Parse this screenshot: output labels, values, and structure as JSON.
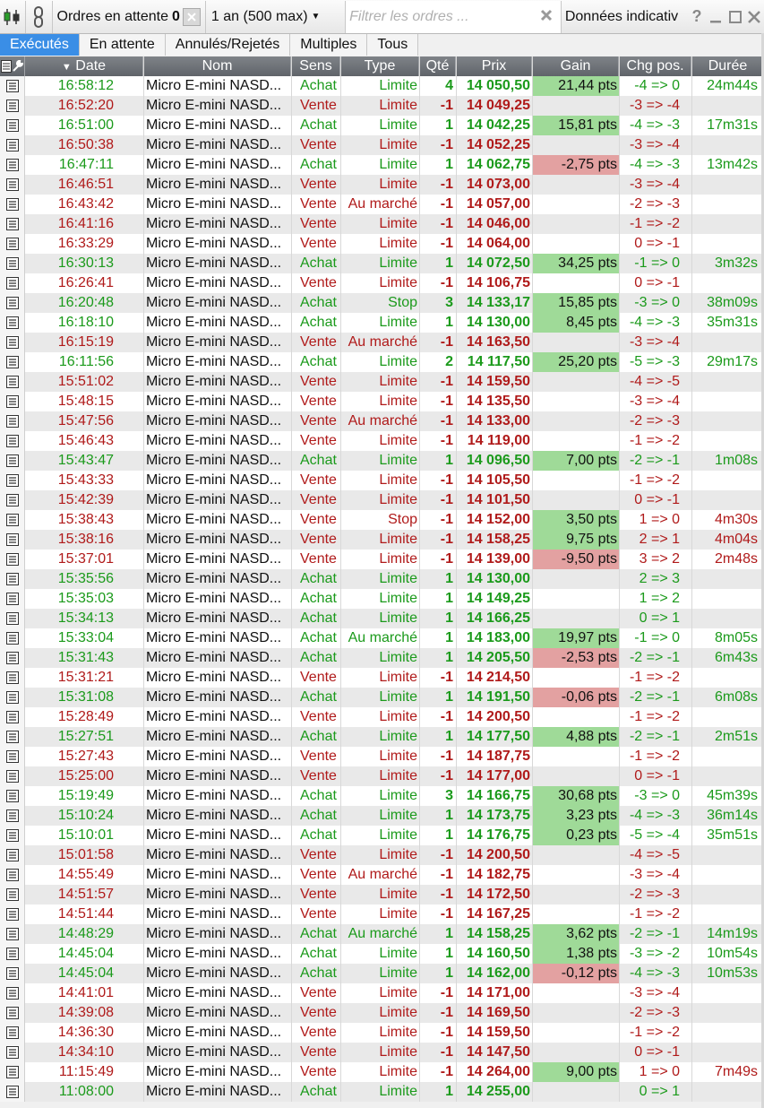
{
  "toolbar": {
    "orders_label": "Ordres en attente",
    "orders_count": "0",
    "period": "1 an (500 max)",
    "filter_placeholder": "Filtrer les ordres ...",
    "data_label": "Données indicativ"
  },
  "tabs": [
    {
      "label": "Exécutés",
      "active": true
    },
    {
      "label": "En attente"
    },
    {
      "label": "Annulés/Rejetés"
    },
    {
      "label": "Multiples"
    },
    {
      "label": "Tous"
    }
  ],
  "columns": {
    "date": "Date",
    "nom": "Nom",
    "sens": "Sens",
    "type": "Type",
    "qte": "Qté",
    "prix": "Prix",
    "gain": "Gain",
    "chg": "Chg pos.",
    "duree": "Durée"
  },
  "colors": {
    "buy": "#1b9a1b",
    "sell": "#b01a1a",
    "gain_pos": "#9fda98",
    "gain_neg": "#e3a1a1",
    "active_tab": "#3a8ee6"
  },
  "rows": [
    {
      "date": "16:58:12",
      "nom": "Micro E-mini NASD...",
      "sens": "Achat",
      "type": "Limite",
      "qte": "4",
      "prix": "14 050,50",
      "gain": "21,44 pts",
      "gain_class": "pos",
      "chg": "-4 => 0",
      "duree": "24m44s",
      "duree_class": "buy"
    },
    {
      "date": "16:52:20",
      "nom": "Micro E-mini NASD...",
      "sens": "Vente",
      "type": "Limite",
      "qte": "-1",
      "prix": "14 049,25",
      "gain": "",
      "gain_class": "",
      "chg": "-3 => -4",
      "duree": "",
      "duree_class": ""
    },
    {
      "date": "16:51:00",
      "nom": "Micro E-mini NASD...",
      "sens": "Achat",
      "type": "Limite",
      "qte": "1",
      "prix": "14 042,25",
      "gain": "15,81 pts",
      "gain_class": "pos",
      "chg": "-4 => -3",
      "duree": "17m31s",
      "duree_class": "buy"
    },
    {
      "date": "16:50:38",
      "nom": "Micro E-mini NASD...",
      "sens": "Vente",
      "type": "Limite",
      "qte": "-1",
      "prix": "14 052,25",
      "gain": "",
      "gain_class": "",
      "chg": "-3 => -4",
      "duree": "",
      "duree_class": ""
    },
    {
      "date": "16:47:11",
      "nom": "Micro E-mini NASD...",
      "sens": "Achat",
      "type": "Limite",
      "qte": "1",
      "prix": "14 062,75",
      "gain": "-2,75 pts",
      "gain_class": "neg",
      "chg": "-4 => -3",
      "duree": "13m42s",
      "duree_class": "buy"
    },
    {
      "date": "16:46:51",
      "nom": "Micro E-mini NASD...",
      "sens": "Vente",
      "type": "Limite",
      "qte": "-1",
      "prix": "14 073,00",
      "gain": "",
      "gain_class": "",
      "chg": "-3 => -4",
      "duree": "",
      "duree_class": ""
    },
    {
      "date": "16:43:42",
      "nom": "Micro E-mini NASD...",
      "sens": "Vente",
      "type": "Au marché",
      "qte": "-1",
      "prix": "14 057,00",
      "gain": "",
      "gain_class": "",
      "chg": "-2 => -3",
      "duree": "",
      "duree_class": ""
    },
    {
      "date": "16:41:16",
      "nom": "Micro E-mini NASD...",
      "sens": "Vente",
      "type": "Limite",
      "qte": "-1",
      "prix": "14 046,00",
      "gain": "",
      "gain_class": "",
      "chg": "-1 => -2",
      "duree": "",
      "duree_class": ""
    },
    {
      "date": "16:33:29",
      "nom": "Micro E-mini NASD...",
      "sens": "Vente",
      "type": "Limite",
      "qte": "-1",
      "prix": "14 064,00",
      "gain": "",
      "gain_class": "",
      "chg": "0 => -1",
      "duree": "",
      "duree_class": ""
    },
    {
      "date": "16:30:13",
      "nom": "Micro E-mini NASD...",
      "sens": "Achat",
      "type": "Limite",
      "qte": "1",
      "prix": "14 072,50",
      "gain": "34,25 pts",
      "gain_class": "pos",
      "chg": "-1 => 0",
      "duree": "3m32s",
      "duree_class": "buy"
    },
    {
      "date": "16:26:41",
      "nom": "Micro E-mini NASD...",
      "sens": "Vente",
      "type": "Limite",
      "qte": "-1",
      "prix": "14 106,75",
      "gain": "",
      "gain_class": "",
      "chg": "0 => -1",
      "duree": "",
      "duree_class": ""
    },
    {
      "date": "16:20:48",
      "nom": "Micro E-mini NASD...",
      "sens": "Achat",
      "type": "Stop",
      "qte": "3",
      "prix": "14 133,17",
      "gain": "15,85 pts",
      "gain_class": "pos",
      "chg": "-3 => 0",
      "duree": "38m09s",
      "duree_class": "buy"
    },
    {
      "date": "16:18:10",
      "nom": "Micro E-mini NASD...",
      "sens": "Achat",
      "type": "Limite",
      "qte": "1",
      "prix": "14 130,00",
      "gain": "8,45 pts",
      "gain_class": "pos",
      "chg": "-4 => -3",
      "duree": "35m31s",
      "duree_class": "buy"
    },
    {
      "date": "16:15:19",
      "nom": "Micro E-mini NASD...",
      "sens": "Vente",
      "type": "Au marché",
      "qte": "-1",
      "prix": "14 163,50",
      "gain": "",
      "gain_class": "",
      "chg": "-3 => -4",
      "duree": "",
      "duree_class": ""
    },
    {
      "date": "16:11:56",
      "nom": "Micro E-mini NASD...",
      "sens": "Achat",
      "type": "Limite",
      "qte": "2",
      "prix": "14 117,50",
      "gain": "25,20 pts",
      "gain_class": "pos",
      "chg": "-5 => -3",
      "duree": "29m17s",
      "duree_class": "buy"
    },
    {
      "date": "15:51:02",
      "nom": "Micro E-mini NASD...",
      "sens": "Vente",
      "type": "Limite",
      "qte": "-1",
      "prix": "14 159,50",
      "gain": "",
      "gain_class": "",
      "chg": "-4 => -5",
      "duree": "",
      "duree_class": ""
    },
    {
      "date": "15:48:15",
      "nom": "Micro E-mini NASD...",
      "sens": "Vente",
      "type": "Limite",
      "qte": "-1",
      "prix": "14 135,50",
      "gain": "",
      "gain_class": "",
      "chg": "-3 => -4",
      "duree": "",
      "duree_class": ""
    },
    {
      "date": "15:47:56",
      "nom": "Micro E-mini NASD...",
      "sens": "Vente",
      "type": "Au marché",
      "qte": "-1",
      "prix": "14 133,00",
      "gain": "",
      "gain_class": "",
      "chg": "-2 => -3",
      "duree": "",
      "duree_class": ""
    },
    {
      "date": "15:46:43",
      "nom": "Micro E-mini NASD...",
      "sens": "Vente",
      "type": "Limite",
      "qte": "-1",
      "prix": "14 119,00",
      "gain": "",
      "gain_class": "",
      "chg": "-1 => -2",
      "duree": "",
      "duree_class": ""
    },
    {
      "date": "15:43:47",
      "nom": "Micro E-mini NASD...",
      "sens": "Achat",
      "type": "Limite",
      "qte": "1",
      "prix": "14 096,50",
      "gain": "7,00 pts",
      "gain_class": "pos",
      "chg": "-2 => -1",
      "duree": "1m08s",
      "duree_class": "buy"
    },
    {
      "date": "15:43:33",
      "nom": "Micro E-mini NASD...",
      "sens": "Vente",
      "type": "Limite",
      "qte": "-1",
      "prix": "14 105,50",
      "gain": "",
      "gain_class": "",
      "chg": "-1 => -2",
      "duree": "",
      "duree_class": ""
    },
    {
      "date": "15:42:39",
      "nom": "Micro E-mini NASD...",
      "sens": "Vente",
      "type": "Limite",
      "qte": "-1",
      "prix": "14 101,50",
      "gain": "",
      "gain_class": "",
      "chg": "0 => -1",
      "duree": "",
      "duree_class": ""
    },
    {
      "date": "15:38:43",
      "nom": "Micro E-mini NASD...",
      "sens": "Vente",
      "type": "Stop",
      "qte": "-1",
      "prix": "14 152,00",
      "gain": "3,50 pts",
      "gain_class": "pos",
      "chg": "1 => 0",
      "duree": "4m30s",
      "duree_class": "sell"
    },
    {
      "date": "15:38:16",
      "nom": "Micro E-mini NASD...",
      "sens": "Vente",
      "type": "Limite",
      "qte": "-1",
      "prix": "14 158,25",
      "gain": "9,75 pts",
      "gain_class": "pos",
      "chg": "2 => 1",
      "duree": "4m04s",
      "duree_class": "sell"
    },
    {
      "date": "15:37:01",
      "nom": "Micro E-mini NASD...",
      "sens": "Vente",
      "type": "Limite",
      "qte": "-1",
      "prix": "14 139,00",
      "gain": "-9,50 pts",
      "gain_class": "neg",
      "chg": "3 => 2",
      "duree": "2m48s",
      "duree_class": "sell"
    },
    {
      "date": "15:35:56",
      "nom": "Micro E-mini NASD...",
      "sens": "Achat",
      "type": "Limite",
      "qte": "1",
      "prix": "14 130,00",
      "gain": "",
      "gain_class": "",
      "chg": "2 => 3",
      "duree": "",
      "duree_class": ""
    },
    {
      "date": "15:35:03",
      "nom": "Micro E-mini NASD...",
      "sens": "Achat",
      "type": "Limite",
      "qte": "1",
      "prix": "14 149,25",
      "gain": "",
      "gain_class": "",
      "chg": "1 => 2",
      "duree": "",
      "duree_class": ""
    },
    {
      "date": "15:34:13",
      "nom": "Micro E-mini NASD...",
      "sens": "Achat",
      "type": "Limite",
      "qte": "1",
      "prix": "14 166,25",
      "gain": "",
      "gain_class": "",
      "chg": "0 => 1",
      "duree": "",
      "duree_class": ""
    },
    {
      "date": "15:33:04",
      "nom": "Micro E-mini NASD...",
      "sens": "Achat",
      "type": "Au marché",
      "qte": "1",
      "prix": "14 183,00",
      "gain": "19,97 pts",
      "gain_class": "pos",
      "chg": "-1 => 0",
      "duree": "8m05s",
      "duree_class": "buy"
    },
    {
      "date": "15:31:43",
      "nom": "Micro E-mini NASD...",
      "sens": "Achat",
      "type": "Limite",
      "qte": "1",
      "prix": "14 205,50",
      "gain": "-2,53 pts",
      "gain_class": "neg",
      "chg": "-2 => -1",
      "duree": "6m43s",
      "duree_class": "buy"
    },
    {
      "date": "15:31:21",
      "nom": "Micro E-mini NASD...",
      "sens": "Vente",
      "type": "Limite",
      "qte": "-1",
      "prix": "14 214,50",
      "gain": "",
      "gain_class": "",
      "chg": "-1 => -2",
      "duree": "",
      "duree_class": ""
    },
    {
      "date": "15:31:08",
      "nom": "Micro E-mini NASD...",
      "sens": "Achat",
      "type": "Limite",
      "qte": "1",
      "prix": "14 191,50",
      "gain": "-0,06 pts",
      "gain_class": "neg",
      "chg": "-2 => -1",
      "duree": "6m08s",
      "duree_class": "buy"
    },
    {
      "date": "15:28:49",
      "nom": "Micro E-mini NASD...",
      "sens": "Vente",
      "type": "Limite",
      "qte": "-1",
      "prix": "14 200,50",
      "gain": "",
      "gain_class": "",
      "chg": "-1 => -2",
      "duree": "",
      "duree_class": ""
    },
    {
      "date": "15:27:51",
      "nom": "Micro E-mini NASD...",
      "sens": "Achat",
      "type": "Limite",
      "qte": "1",
      "prix": "14 177,50",
      "gain": "4,88 pts",
      "gain_class": "pos",
      "chg": "-2 => -1",
      "duree": "2m51s",
      "duree_class": "buy"
    },
    {
      "date": "15:27:43",
      "nom": "Micro E-mini NASD...",
      "sens": "Vente",
      "type": "Limite",
      "qte": "-1",
      "prix": "14 187,75",
      "gain": "",
      "gain_class": "",
      "chg": "-1 => -2",
      "duree": "",
      "duree_class": ""
    },
    {
      "date": "15:25:00",
      "nom": "Micro E-mini NASD...",
      "sens": "Vente",
      "type": "Limite",
      "qte": "-1",
      "prix": "14 177,00",
      "gain": "",
      "gain_class": "",
      "chg": "0 => -1",
      "duree": "",
      "duree_class": ""
    },
    {
      "date": "15:19:49",
      "nom": "Micro E-mini NASD...",
      "sens": "Achat",
      "type": "Limite",
      "qte": "3",
      "prix": "14 166,75",
      "gain": "30,68 pts",
      "gain_class": "pos",
      "chg": "-3 => 0",
      "duree": "45m39s",
      "duree_class": "buy"
    },
    {
      "date": "15:10:24",
      "nom": "Micro E-mini NASD...",
      "sens": "Achat",
      "type": "Limite",
      "qte": "1",
      "prix": "14 173,75",
      "gain": "3,23 pts",
      "gain_class": "pos",
      "chg": "-4 => -3",
      "duree": "36m14s",
      "duree_class": "buy"
    },
    {
      "date": "15:10:01",
      "nom": "Micro E-mini NASD...",
      "sens": "Achat",
      "type": "Limite",
      "qte": "1",
      "prix": "14 176,75",
      "gain": "0,23 pts",
      "gain_class": "pos",
      "chg": "-5 => -4",
      "duree": "35m51s",
      "duree_class": "buy"
    },
    {
      "date": "15:01:58",
      "nom": "Micro E-mini NASD...",
      "sens": "Vente",
      "type": "Limite",
      "qte": "-1",
      "prix": "14 200,50",
      "gain": "",
      "gain_class": "",
      "chg": "-4 => -5",
      "duree": "",
      "duree_class": ""
    },
    {
      "date": "14:55:49",
      "nom": "Micro E-mini NASD...",
      "sens": "Vente",
      "type": "Au marché",
      "qte": "-1",
      "prix": "14 182,75",
      "gain": "",
      "gain_class": "",
      "chg": "-3 => -4",
      "duree": "",
      "duree_class": ""
    },
    {
      "date": "14:51:57",
      "nom": "Micro E-mini NASD...",
      "sens": "Vente",
      "type": "Limite",
      "qte": "-1",
      "prix": "14 172,50",
      "gain": "",
      "gain_class": "",
      "chg": "-2 => -3",
      "duree": "",
      "duree_class": ""
    },
    {
      "date": "14:51:44",
      "nom": "Micro E-mini NASD...",
      "sens": "Vente",
      "type": "Limite",
      "qte": "-1",
      "prix": "14 167,25",
      "gain": "",
      "gain_class": "",
      "chg": "-1 => -2",
      "duree": "",
      "duree_class": ""
    },
    {
      "date": "14:48:29",
      "nom": "Micro E-mini NASD...",
      "sens": "Achat",
      "type": "Au marché",
      "qte": "1",
      "prix": "14 158,25",
      "gain": "3,62 pts",
      "gain_class": "pos",
      "chg": "-2 => -1",
      "duree": "14m19s",
      "duree_class": "buy"
    },
    {
      "date": "14:45:04",
      "nom": "Micro E-mini NASD...",
      "sens": "Achat",
      "type": "Limite",
      "qte": "1",
      "prix": "14 160,50",
      "gain": "1,38 pts",
      "gain_class": "pos",
      "chg": "-3 => -2",
      "duree": "10m54s",
      "duree_class": "buy"
    },
    {
      "date": "14:45:04",
      "nom": "Micro E-mini NASD...",
      "sens": "Achat",
      "type": "Limite",
      "qte": "1",
      "prix": "14 162,00",
      "gain": "-0,12 pts",
      "gain_class": "neg",
      "chg": "-4 => -3",
      "duree": "10m53s",
      "duree_class": "buy"
    },
    {
      "date": "14:41:01",
      "nom": "Micro E-mini NASD...",
      "sens": "Vente",
      "type": "Limite",
      "qte": "-1",
      "prix": "14 171,00",
      "gain": "",
      "gain_class": "",
      "chg": "-3 => -4",
      "duree": "",
      "duree_class": ""
    },
    {
      "date": "14:39:08",
      "nom": "Micro E-mini NASD...",
      "sens": "Vente",
      "type": "Limite",
      "qte": "-1",
      "prix": "14 169,50",
      "gain": "",
      "gain_class": "",
      "chg": "-2 => -3",
      "duree": "",
      "duree_class": ""
    },
    {
      "date": "14:36:30",
      "nom": "Micro E-mini NASD...",
      "sens": "Vente",
      "type": "Limite",
      "qte": "-1",
      "prix": "14 159,50",
      "gain": "",
      "gain_class": "",
      "chg": "-1 => -2",
      "duree": "",
      "duree_class": ""
    },
    {
      "date": "14:34:10",
      "nom": "Micro E-mini NASD...",
      "sens": "Vente",
      "type": "Limite",
      "qte": "-1",
      "prix": "14 147,50",
      "gain": "",
      "gain_class": "",
      "chg": "0 => -1",
      "duree": "",
      "duree_class": ""
    },
    {
      "date": "11:15:49",
      "nom": "Micro E-mini NASD...",
      "sens": "Vente",
      "type": "Limite",
      "qte": "-1",
      "prix": "14 264,00",
      "gain": "9,00 pts",
      "gain_class": "pos",
      "chg": "1 => 0",
      "duree": "7m49s",
      "duree_class": "sell"
    },
    {
      "date": "11:08:00",
      "nom": "Micro E-mini NASD...",
      "sens": "Achat",
      "type": "Limite",
      "qte": "1",
      "prix": "14 255,00",
      "gain": "",
      "gain_class": "",
      "chg": "0 => 1",
      "duree": "",
      "duree_class": ""
    }
  ]
}
